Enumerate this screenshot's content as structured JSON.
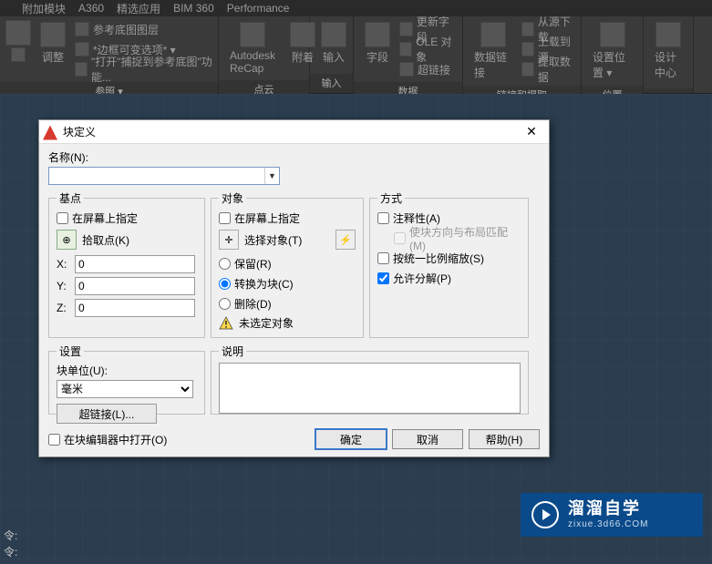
{
  "ribbon_tabs": {
    "t1": "附加模块",
    "t2": "A360",
    "t3": "精选应用",
    "t4": "BIM 360",
    "t5": "Performance"
  },
  "ribbon": {
    "panel1": {
      "label": "参照 ▾",
      "row1a": "参考底图图层",
      "row2a": "*边框可变选项* ▾",
      "row3a": "\"打开\"捕捉到参考底图\"功能...",
      "adjust": "调整"
    },
    "panel2": {
      "label": "点云",
      "big": "Autodesk ReCap",
      "attach": "附着"
    },
    "panel3": {
      "label": "输入",
      "big": "输入"
    },
    "panel4": {
      "label": "数据",
      "big": "字段",
      "row1": "更新字段",
      "row2": "OLE 对象",
      "row3": "超链接"
    },
    "panel5": {
      "label": "链接和提取",
      "big": "数据链接",
      "row1": "从源下载",
      "row2": "上载到源",
      "row3": "提取数据"
    },
    "panel6": {
      "label": "位置",
      "big": "设置位置 ▾"
    },
    "panel7": {
      "label": "",
      "big": "设计中心"
    }
  },
  "dialog": {
    "title": "块定义",
    "name_label": "名称(N):",
    "name_value": "",
    "base": {
      "legend": "基点",
      "on_screen": "在屏幕上指定",
      "pick": "拾取点(K)",
      "x_label": "X:",
      "x_val": "0",
      "y_label": "Y:",
      "y_val": "0",
      "z_label": "Z:",
      "z_val": "0"
    },
    "obj": {
      "legend": "对象",
      "on_screen": "在屏幕上指定",
      "select": "选择对象(T)",
      "keep": "保留(R)",
      "convert": "转换为块(C)",
      "delete": "删除(D)",
      "warn": "未选定对象"
    },
    "mode": {
      "legend": "方式",
      "annotative": "注释性(A)",
      "orient": "使块方向与布局匹配(M)",
      "uniform": "按统一比例缩放(S)",
      "explode": "允许分解(P)"
    },
    "settings": {
      "legend": "设置",
      "units_label": "块单位(U):",
      "units_value": "毫米",
      "hyperlink": "超链接(L)..."
    },
    "desc_legend": "说明",
    "desc_value": "",
    "open_editor": "在块编辑器中打开(O)",
    "ok": "确定",
    "cancel": "取消",
    "help": "帮助(H)"
  },
  "status": {
    "line1": "令:",
    "line2": "令:"
  },
  "watermark": {
    "big": "溜溜自学",
    "small": "zixue.3d66.COM"
  }
}
